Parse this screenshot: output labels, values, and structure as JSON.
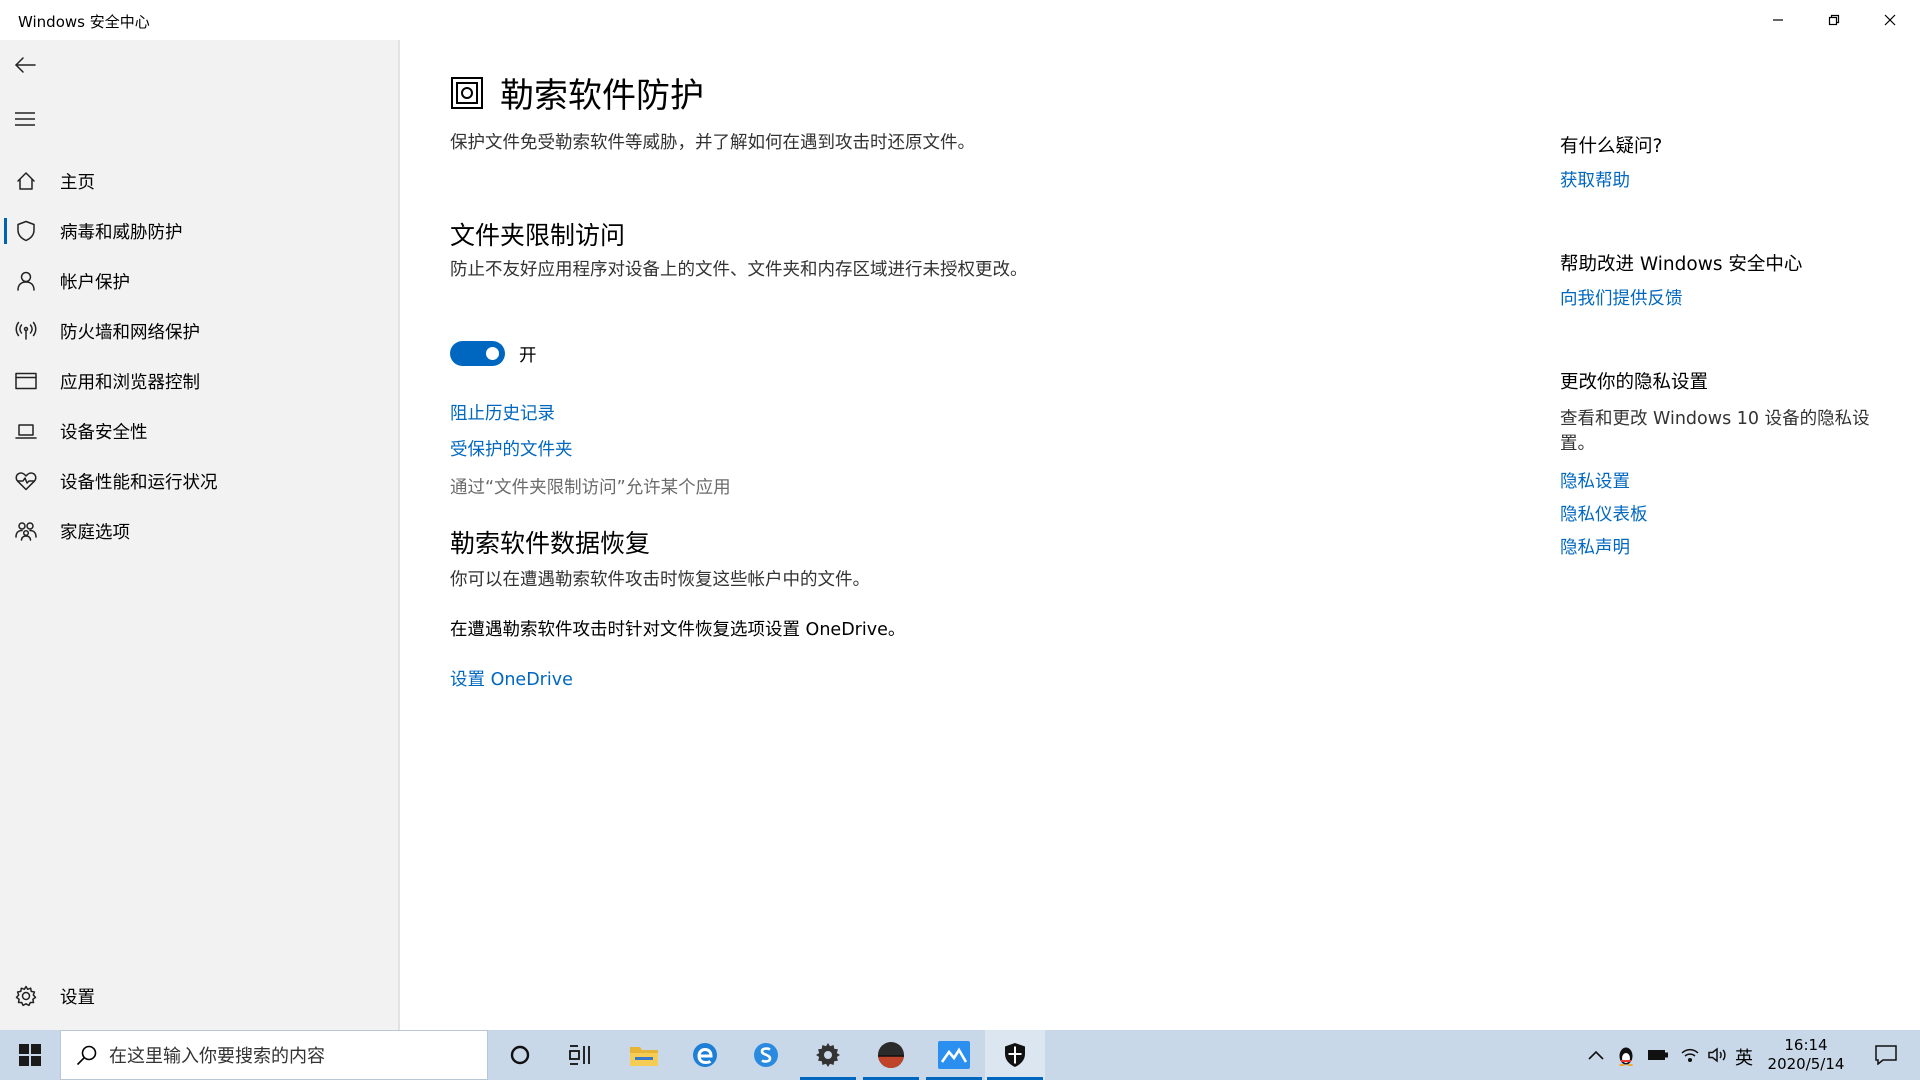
{
  "window": {
    "title": "Windows 安全中心",
    "controls": [
      "minimize",
      "restore",
      "close"
    ]
  },
  "sidebar": {
    "items": [
      {
        "label": "主页",
        "icon": "home-icon"
      },
      {
        "label": "病毒和威胁防护",
        "icon": "shield-icon",
        "active": true
      },
      {
        "label": "帐户保护",
        "icon": "person-icon"
      },
      {
        "label": "防火墙和网络保护",
        "icon": "antenna-icon"
      },
      {
        "label": "应用和浏览器控制",
        "icon": "browser-window-icon"
      },
      {
        "label": "设备安全性",
        "icon": "laptop-icon"
      },
      {
        "label": "设备性能和运行状况",
        "icon": "heart-icon"
      },
      {
        "label": "家庭选项",
        "icon": "family-icon"
      }
    ],
    "settings_label": "设置"
  },
  "main": {
    "title": "勒索软件防护",
    "description": "保护文件免受勒索软件等威胁，并了解如何在遇到攻击时还原文件。",
    "folder_access": {
      "title": "文件夹限制访问",
      "description": "防止不友好应用程序对设备上的文件、文件夹和内存区域进行未授权更改。",
      "toggle_state": "开",
      "toggle_on": true,
      "links": [
        "阻止历史记录",
        "受保护的文件夹"
      ],
      "disabled_text": "通过“文件夹限制访问”允许某个应用"
    },
    "recovery": {
      "title": "勒索软件数据恢复",
      "description": "你可以在遭遇勒索软件攻击时恢复这些帐户中的文件。",
      "onedrive_text": "在遭遇勒索软件攻击时针对文件恢复选项设置 OneDrive。",
      "onedrive_link": "设置 OneDrive"
    }
  },
  "right_panel": {
    "question_heading": "有什么疑问?",
    "help_link": "获取帮助",
    "improve_heading": "帮助改进 Windows 安全中心",
    "feedback_link": "向我们提供反馈",
    "privacy_heading": "更改你的隐私设置",
    "privacy_text": "查看和更改 Windows 10 设备的隐私设置。",
    "privacy_links": [
      "隐私设置",
      "隐私仪表板",
      "隐私声明"
    ]
  },
  "taskbar": {
    "search_placeholder": "在这里输入你要搜索的内容",
    "ime_label": "英",
    "time": "16:14",
    "date": "2020/5/14"
  },
  "colors": {
    "accent": "#0067c0",
    "sidebar_bg": "#f2f2f2",
    "taskbar_bg": "#c9d8e8"
  }
}
